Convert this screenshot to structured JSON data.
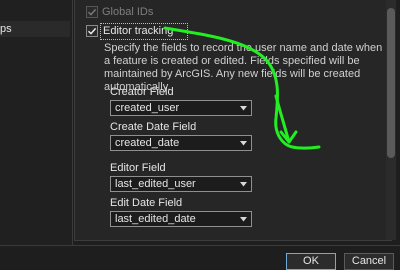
{
  "left_pane": {
    "selected_item_fragment": "ps"
  },
  "options": {
    "global_ids": {
      "label": "Global IDs",
      "checked": true,
      "enabled": false
    },
    "editor_tracking": {
      "label": "Editor tracking",
      "checked": true,
      "enabled": true
    }
  },
  "description": "Specify the fields to record the user name and date when a feature is created or edited. Fields specified will be maintained by ArcGIS. Any new fields will be created automatically.",
  "fields": [
    {
      "label": "Creator Field",
      "value": "created_user"
    },
    {
      "label": "Create Date Field",
      "value": "created_date"
    },
    {
      "label": "Editor Field",
      "value": "last_edited_user"
    },
    {
      "label": "Edit Date Field",
      "value": "last_edited_date"
    }
  ],
  "buttons": {
    "ok": "OK",
    "cancel": "Cancel"
  },
  "colors": {
    "background": "#262626",
    "annotation": "#22ee22",
    "ok_border": "#6fa8dc"
  }
}
